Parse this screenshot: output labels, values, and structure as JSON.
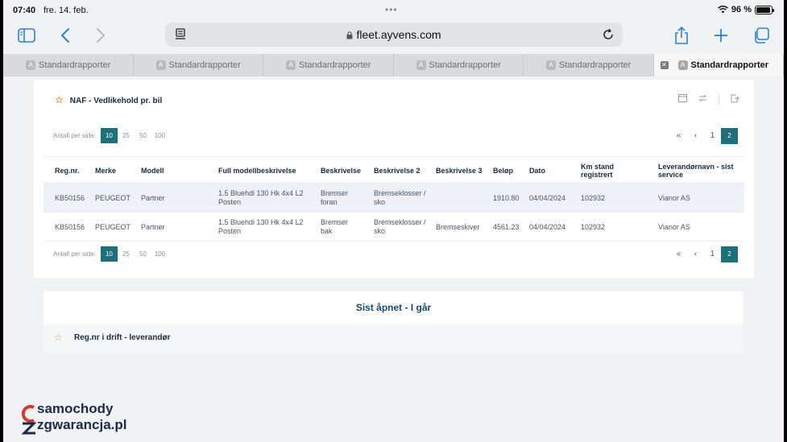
{
  "status": {
    "time": "07:40",
    "date": "fre. 14. feb.",
    "battery": "96 %",
    "battery_level": 0.96
  },
  "browser": {
    "url": "fleet.ayvens.com",
    "tabs": [
      {
        "label": "Standardrapporter"
      },
      {
        "label": "Standardrapporter"
      },
      {
        "label": "Standardrapporter"
      },
      {
        "label": "Standardrapporter"
      },
      {
        "label": "Standardrapporter"
      },
      {
        "label": "Standardrapporter"
      }
    ]
  },
  "report": {
    "title": "NAF - Vedlikehold pr. bil",
    "per_page_label": "Antall per side:",
    "per_page_options": [
      "10",
      "25",
      "50",
      "100"
    ],
    "selected_per_page": "10",
    "pages": [
      "1",
      "2"
    ],
    "current_page": "2",
    "nav_first": "«",
    "nav_prev": "‹",
    "columns": [
      "Reg.nr.",
      "Merke",
      "Modell",
      "Full modellbeskrivelse",
      "Beskrivelse",
      "Beskrivelse 2",
      "Beskrivelse 3",
      "Beløp",
      "Dato",
      "Km stand registrert",
      "Leverandørnavn - sist service"
    ],
    "rows": [
      [
        "KB50156",
        "PEUGEOT",
        "Partner",
        "1.5 Bluehdi 130 Hk 4x4 L2 Posten",
        "Bremser foran",
        "Bremseklosser / sko",
        "",
        "1910.80",
        "04/04/2024",
        "102932",
        "Vianor AS"
      ],
      [
        "KB50156",
        "PEUGEOT",
        "Partner",
        "1.5 Bluehdi 130 Hk 4x4 L2 Posten",
        "Bremser bak",
        "Bremseklosser / sko",
        "Bremseskiver",
        "4561.23",
        "04/04/2024",
        "102932",
        "Vianor AS"
      ]
    ]
  },
  "recent": {
    "heading": "Sist åpnet - I går",
    "item": "Reg.nr i drift - leverandør"
  },
  "watermark": {
    "line1": "samochody",
    "line2": "zgwarancja.pl"
  }
}
